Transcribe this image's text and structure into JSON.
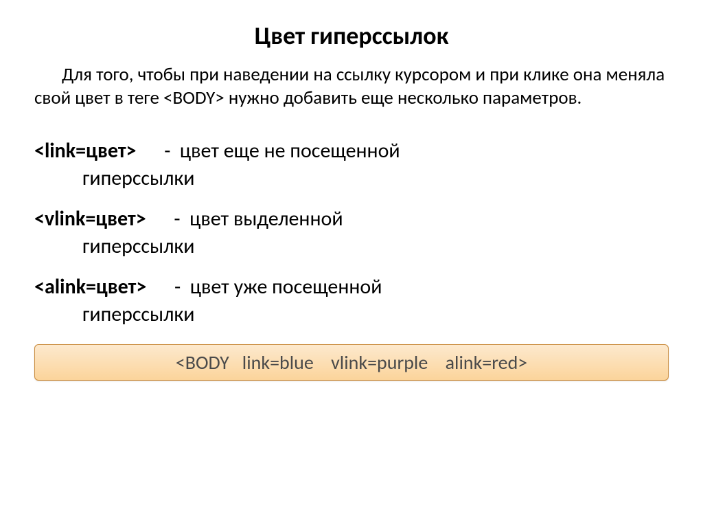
{
  "title": "Цвет гиперссылок",
  "intro": "Для того, чтобы при наведении на ссылку курсором и при клике она меняла свой цвет в теге <BODY> нужно добавить еще несколько параметров.",
  "defs": [
    {
      "term": "<link=цвет>",
      "gap": "      ",
      "line1": "-  цвет еще не посещенной",
      "cont": "гиперссылки"
    },
    {
      "term": "<vlink=цвет>",
      "gap": "      ",
      "line1": "-  цвет выделенной",
      "cont": "гиперссылки"
    },
    {
      "term": "<alink=цвет>",
      "gap": "      ",
      "line1": "-  цвет уже посещенной",
      "cont": "гиперссылки"
    }
  ],
  "code_example": "<BODY   link=blue    vlink=purple    alink=red>"
}
